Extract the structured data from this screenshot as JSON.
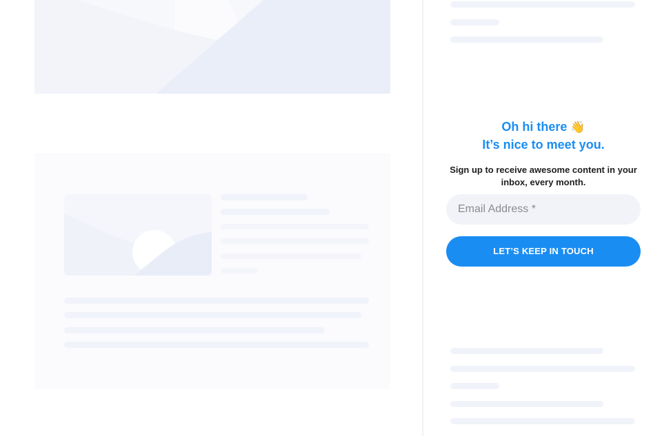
{
  "newsletter": {
    "greeting_line1": "Oh hi there",
    "greeting_emoji": "👋",
    "greeting_line2": "It’s nice to meet you.",
    "description": "Sign up to receive awesome content in your inbox, every month.",
    "email_placeholder": "Email Address *",
    "email_value": "",
    "submit_label": "LET’S KEEP IN TOUCH"
  },
  "colors": {
    "accent": "#1a8df2",
    "skeleton": "#f1f3fa",
    "input_bg": "#f2f3f8"
  },
  "icons": {
    "wave": "waving-hand-icon",
    "placeholder_image": "image-placeholder-icon"
  }
}
